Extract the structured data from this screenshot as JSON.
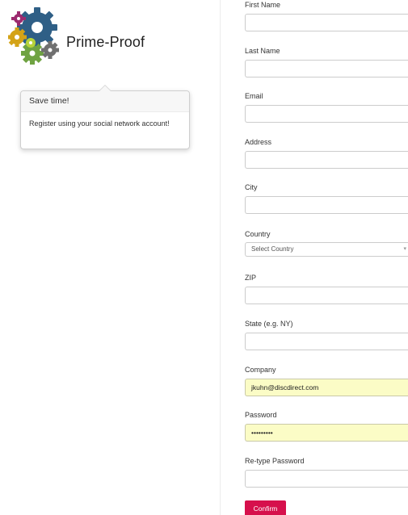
{
  "logo": {
    "text": "Prime-Proof",
    "gear_colors": [
      "#2f5f86",
      "#b6d33a",
      "#d4a317",
      "#6fa342",
      "#9c2a6f",
      "#707070"
    ]
  },
  "popover": {
    "title": "Save time!",
    "content": "Register using your social network account!"
  },
  "form": {
    "first_name": {
      "label": "First Name",
      "value": ""
    },
    "last_name": {
      "label": "Last Name",
      "value": ""
    },
    "email": {
      "label": "Email",
      "value": ""
    },
    "address": {
      "label": "Address",
      "value": ""
    },
    "city": {
      "label": "City",
      "value": ""
    },
    "country": {
      "label": "Country",
      "selected": "Select Country"
    },
    "zip": {
      "label": "ZIP",
      "value": ""
    },
    "state": {
      "label": "State (e.g. NY)",
      "value": ""
    },
    "company": {
      "label": "Company",
      "value": "jkuhn@discdirect.com"
    },
    "password": {
      "label": "Password",
      "value": "•••••••••"
    },
    "retype_password": {
      "label": "Re-type Password",
      "value": ""
    },
    "confirm_label": "Confirm"
  },
  "colors": {
    "confirm_button": "#d6104c",
    "autofill_background": "#fbfcc6"
  }
}
